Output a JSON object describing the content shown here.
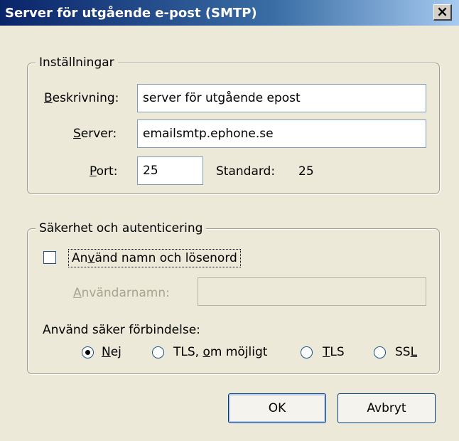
{
  "window": {
    "title": "Server för utgående e-post (SMTP)",
    "close_glyph": "×"
  },
  "settings": {
    "legend": "Inställningar",
    "description": {
      "label_u": "B",
      "label_rest": "eskrivning:",
      "value": "server för utgående epost"
    },
    "server": {
      "label_u": "S",
      "label_rest": "erver:",
      "value": "emailsmtp.ephone.se"
    },
    "port": {
      "label_u": "P",
      "label_rest": "ort:",
      "value": "25",
      "default_label": "Standard:",
      "default_value": "25"
    }
  },
  "security": {
    "legend": "Säkerhet och autenticering",
    "use_auth": {
      "label_pre": "An",
      "label_u": "v",
      "label_rest": "änd namn och lösenord",
      "checked": false
    },
    "username": {
      "label_u": "A",
      "label_rest": "nvändarnamn:",
      "value": ""
    },
    "secure_label": "Använd säker förbindelse:",
    "options": [
      {
        "pre": "",
        "u": "N",
        "post": "ej",
        "checked": true
      },
      {
        "pre": "TLS, ",
        "u": "o",
        "post": "m möjligt",
        "checked": false
      },
      {
        "pre": "",
        "u": "T",
        "post": "LS",
        "checked": false
      },
      {
        "pre": "SS",
        "u": "L",
        "post": "",
        "checked": false
      }
    ]
  },
  "buttons": {
    "ok": "OK",
    "cancel": "Avbryt"
  }
}
